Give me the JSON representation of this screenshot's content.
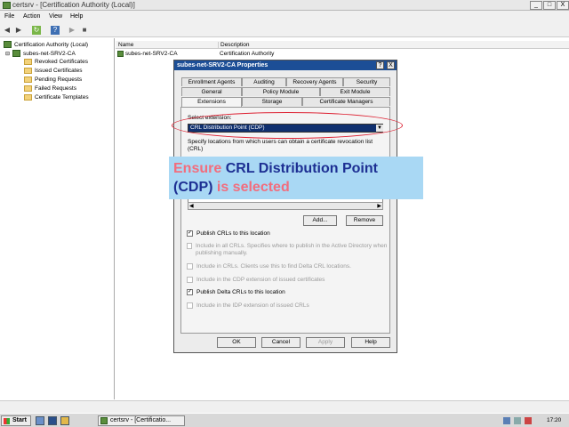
{
  "window": {
    "title": "certsrv - [Certification Authority (Local)]",
    "min": "_",
    "max": "□",
    "close": "X"
  },
  "menu": [
    "File",
    "Action",
    "View",
    "Help"
  ],
  "tree": {
    "root": "Certification Authority (Local)",
    "ca": "subes-net-SRV2-CA",
    "folders": [
      "Revoked Certificates",
      "Issued Certificates",
      "Pending Requests",
      "Failed Requests",
      "Certificate Templates"
    ]
  },
  "list": {
    "columns": [
      "Name",
      "Description"
    ],
    "rows": [
      {
        "name": "subes-net-SRV2-CA",
        "description": "Certification Authority"
      }
    ]
  },
  "dialog": {
    "title": "subes-net-SRV2-CA Properties",
    "help": "?",
    "close": "X",
    "tabs_row1": [
      "Enrollment Agents",
      "Auditing",
      "Recovery Agents",
      "Security"
    ],
    "tabs_row2": [
      "General",
      "Policy Module",
      "Exit Module"
    ],
    "tabs_row3": [
      "Extensions",
      "Storage",
      "Certificate Managers"
    ],
    "select_label": "Select extension:",
    "selected_extension": "CRL Distribution Point (CDP)",
    "description": "Specify locations from which users can obtain a certificate revocation list (CRL)",
    "add_button": "Add...",
    "remove_button": "Remove",
    "options": [
      {
        "label": "Publish CRLs to this location",
        "checked": true,
        "enabled": true
      },
      {
        "label": "Include in all CRLs. Specifies where to publish in the Active Directory when publishing manually.",
        "checked": false,
        "enabled": false
      },
      {
        "label": "Include in CRLs. Clients use this to find Delta CRL locations.",
        "checked": false,
        "enabled": false
      },
      {
        "label": "Include in the CDP extension of issued certificates",
        "checked": false,
        "enabled": false
      },
      {
        "label": "Publish Delta CRLs to this location",
        "checked": true,
        "enabled": true
      },
      {
        "label": "Include in the IDP extension of issued CRLs",
        "checked": false,
        "enabled": false
      }
    ],
    "ok": "OK",
    "cancel": "Cancel",
    "apply": "Apply",
    "help_button": "Help"
  },
  "callout": {
    "word1": "Ensure",
    "word2": "CRL Distribution Point",
    "word3": "(CDP)",
    "word4": "is selected"
  },
  "taskbar": {
    "start": "Start",
    "task": "certsrv - [Certificatio...",
    "clock": "17:20"
  }
}
